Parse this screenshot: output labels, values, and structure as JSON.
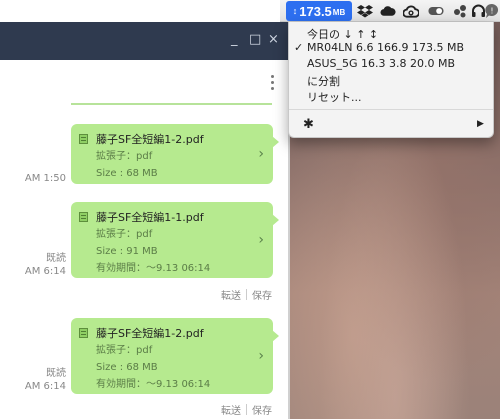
{
  "menubar": {
    "speed_arrows": "↕",
    "speed_value": "173.5",
    "speed_unit": "MB",
    "tray_icons": [
      "dropbox-icon",
      "cloud-icon",
      "creative-cloud-icon",
      "toggle-icon",
      "share-icon",
      "headphones-icon",
      "chat-icon"
    ]
  },
  "window": {
    "minimize": "_",
    "maximize": "□",
    "close": "×"
  },
  "dropdown": {
    "header": "今日の ↓ ↑ ↕",
    "items": [
      {
        "label": "MR04LN 6.6 166.9 173.5  MB",
        "checked": true
      },
      {
        "label": "ASUS_5G 16.3 3.8 20.0  MB",
        "checked": false
      },
      {
        "label": "に分割",
        "checked": false
      },
      {
        "label": "リセット...",
        "checked": false
      }
    ],
    "checkmark": "✓",
    "settings_arrow": "▶"
  },
  "messages": [
    {
      "file_name": "藤子SF全短編1-2.pdf",
      "ext_label": "拡張子：pdf",
      "size_label": "Size : 68 MB",
      "expiry": "",
      "read": "",
      "time": "AM 1:50",
      "actions": []
    },
    {
      "file_name": "藤子SF全短編1-1.pdf",
      "ext_label": "拡張子：pdf",
      "size_label": "Size : 91 MB",
      "expiry": "有効期間：〜9.13 06:14",
      "read": "既読",
      "time": "AM 6:14",
      "actions": [
        "転送",
        "保存"
      ]
    },
    {
      "file_name": "藤子SF全短編1-2.pdf",
      "ext_label": "拡張子：pdf",
      "size_label": "Size : 68 MB",
      "expiry": "有効期間：〜9.13 06:14",
      "read": "既読",
      "time": "AM 6:14",
      "actions": [
        "転送",
        "保存"
      ]
    }
  ],
  "colors": {
    "menubar_highlight": "#2d6ff0",
    "titlebar": "#2f3a4f",
    "bubble": "#b6ea8f"
  }
}
